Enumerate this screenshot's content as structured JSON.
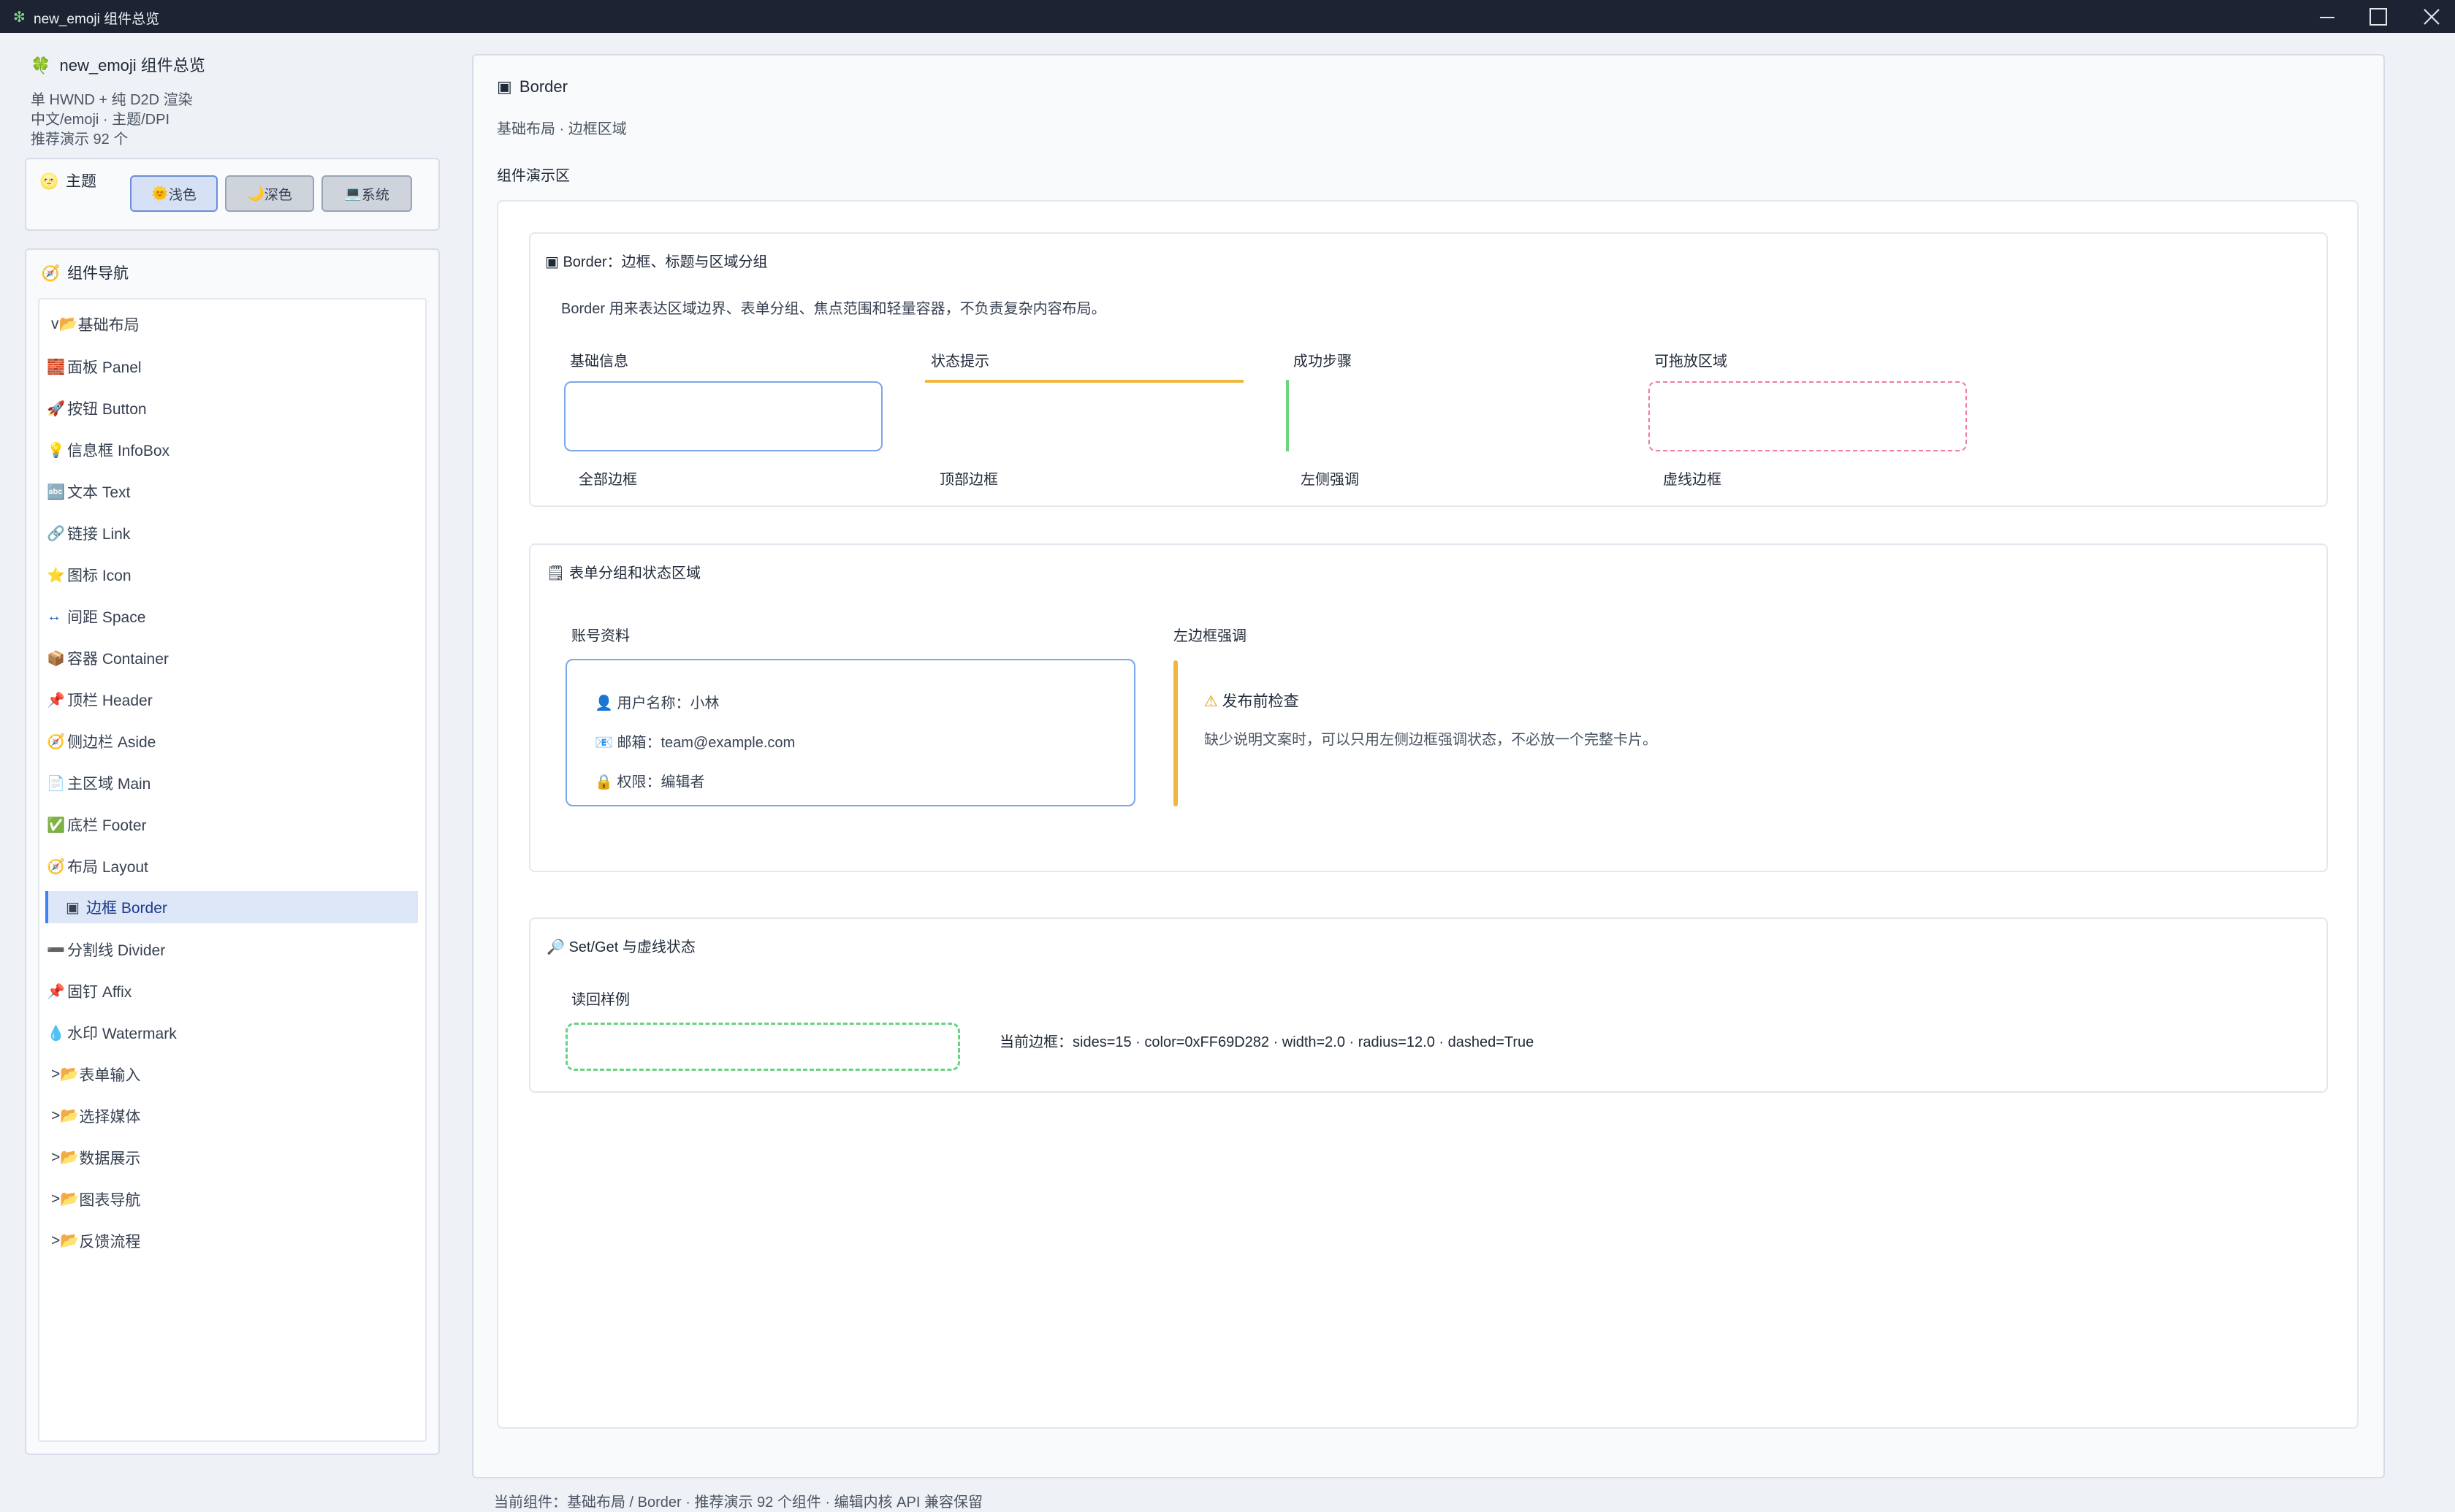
{
  "window": {
    "title": "new_emoji 组件总览",
    "logo_glyph": "❇",
    "controls": [
      "minimize-icon",
      "maximize-icon",
      "close-icon"
    ]
  },
  "sidebar": {
    "app_title": "new_emoji 组件总览",
    "app_icon": "🍀",
    "info_lines": [
      "单 HWND + 纯 D2D 渲染",
      "中文/emoji · 主题/DPI",
      "推荐演示 92 个"
    ],
    "theme": {
      "title": "主题",
      "icon": "🌝",
      "buttons": [
        {
          "icon": "🌞",
          "label": "浅色",
          "active": true
        },
        {
          "icon": "🌙",
          "label": "深色",
          "active": false
        },
        {
          "icon": "💻",
          "label": "系统",
          "active": false
        }
      ]
    },
    "nav": {
      "title": "组件导航",
      "icon": "🧭",
      "expanded_group": {
        "marker": "v",
        "icon": "📂",
        "label": "基础布局"
      },
      "items": [
        {
          "icon": "🧱",
          "label": "面板 Panel"
        },
        {
          "icon": "🚀",
          "label": "按钮 Button"
        },
        {
          "icon": "💡",
          "label": "信息框 InfoBox"
        },
        {
          "icon": "🔤",
          "label": "文本 Text"
        },
        {
          "icon": "🔗",
          "label": "链接 Link"
        },
        {
          "icon": "⭐",
          "label": "图标 Icon"
        },
        {
          "icon": "↔",
          "label": "间距 Space"
        },
        {
          "icon": "📦",
          "label": "容器 Container"
        },
        {
          "icon": "📌",
          "label": "顶栏 Header"
        },
        {
          "icon": "🧭",
          "label": "侧边栏 Aside"
        },
        {
          "icon": "📄",
          "label": "主区域 Main"
        },
        {
          "icon": "✅",
          "label": "底栏 Footer"
        },
        {
          "icon": "🧭",
          "label": "布局 Layout"
        },
        {
          "icon": "▣",
          "label": "边框 Border",
          "selected": true
        },
        {
          "icon": "➖",
          "label": "分割线 Divider"
        },
        {
          "icon": "📌",
          "label": "固钉 Affix"
        },
        {
          "icon": "💧",
          "label": "水印 Watermark"
        }
      ],
      "collapsed_groups": [
        {
          "marker": ">",
          "icon": "📂",
          "label": "表单输入"
        },
        {
          "marker": ">",
          "icon": "📂",
          "label": "选择媒体"
        },
        {
          "marker": ">",
          "icon": "📂",
          "label": "数据展示"
        },
        {
          "marker": ">",
          "icon": "📂",
          "label": "图表导航"
        },
        {
          "marker": ">",
          "icon": "📂",
          "label": "反馈流程"
        }
      ]
    }
  },
  "main": {
    "title_icon": "▣",
    "title": "Border",
    "breadcrumb": "基础布局 · 边框区域",
    "demo_title": "组件演示区",
    "section1": {
      "icon": "▣",
      "title": "Border：边框、标题与区域分组",
      "desc": "Border 用来表达区域边界、表单分组、焦点范围和轻量容器，不负责复杂内容布局。",
      "samples": [
        {
          "title": "基础信息",
          "caption": "全部边框"
        },
        {
          "title": "状态提示",
          "caption": "顶部边框"
        },
        {
          "title": "成功步骤",
          "caption": "左侧强调"
        },
        {
          "title": "可拖放区域",
          "caption": "虚线边框"
        }
      ]
    },
    "section2": {
      "icon": "🗒",
      "title": "表单分组和状态区域",
      "account_title": "账号资料",
      "rows": [
        {
          "icon": "👤",
          "text": "用户名称：小林"
        },
        {
          "icon": "📧",
          "text": "邮箱：team@example.com"
        },
        {
          "icon": "🔒",
          "text": "权限：编辑者"
        }
      ],
      "accent_title": "左边框强调",
      "warn_icon": "⚠",
      "warn_title": "发布前检查",
      "warn_body": "缺少说明文案时，可以只用左侧边框强调状态，不必放一个完整卡片。"
    },
    "section3": {
      "icon": "🔎",
      "title": "Set/Get 与虚线状态",
      "readback_title": "读回样例",
      "readout": "当前边框：sides=15 · color=0xFF69D282 · width=2.0 · radius=12.0 · dashed=True"
    }
  },
  "status_bar": "当前组件：基础布局 / Border · 推荐演示 92 个组件 · 编辑内核 API 兼容保留",
  "colors": {
    "accent": "#3b82f6",
    "border_blue": "#7aa7e8",
    "top_orange": "#f2b640",
    "left_green": "#6fd37f",
    "dashed_pink": "#f07aa5",
    "dashed_green": "#69d282",
    "warn_amber": "#f2b640"
  }
}
